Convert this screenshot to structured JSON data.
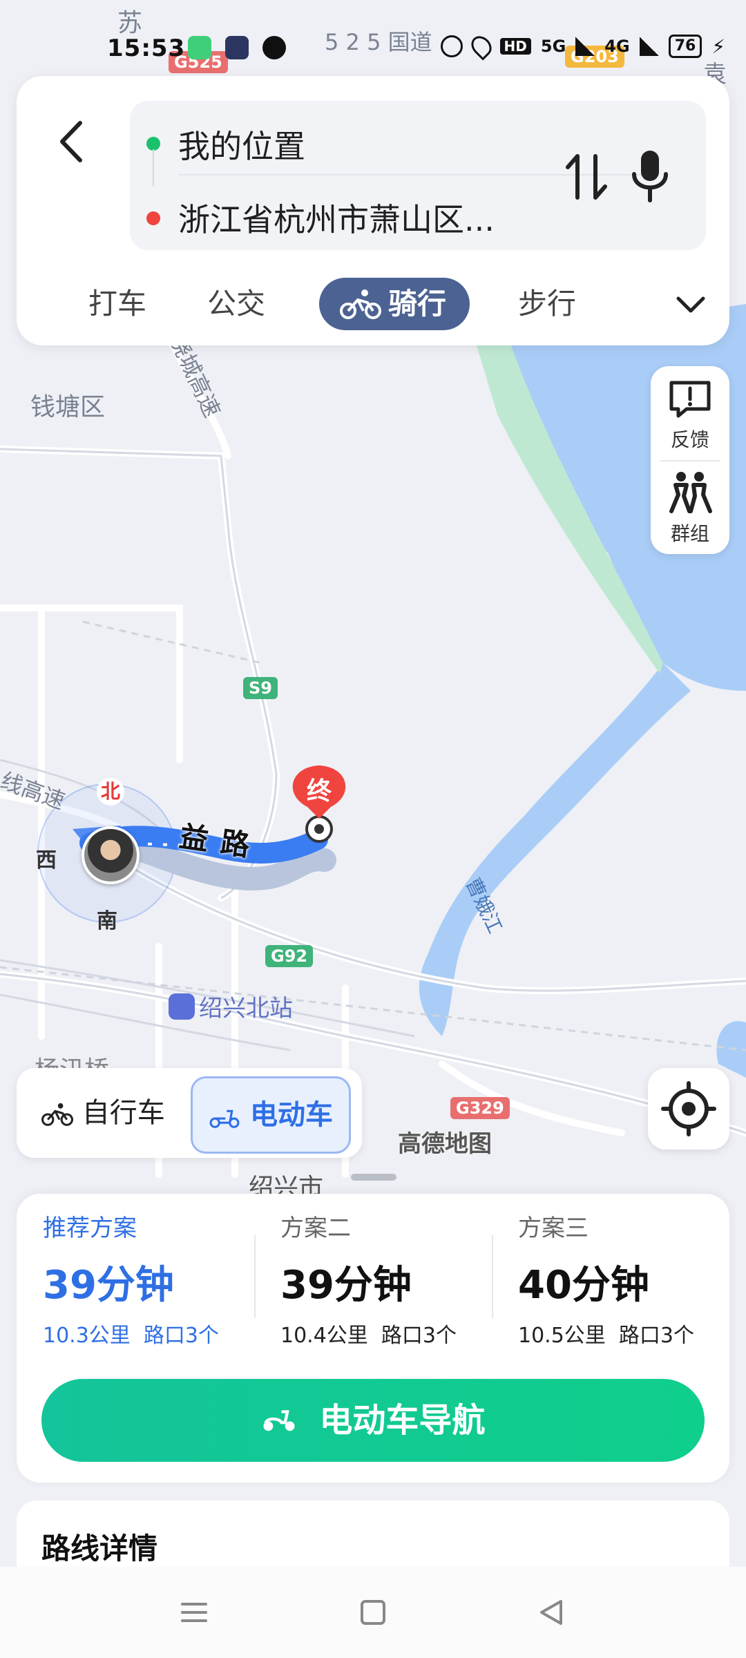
{
  "status_bar": {
    "time": "15:53",
    "network_1": "5G",
    "network_2": "4G",
    "battery": "76"
  },
  "search": {
    "origin": "我的位置",
    "destination": "浙江省杭州市萧山区..."
  },
  "mode_tabs": [
    {
      "label": "打车"
    },
    {
      "label": "公交"
    },
    {
      "label": "骑行"
    },
    {
      "label": "步行"
    }
  ],
  "side_panel": {
    "feedback_label": "反馈",
    "group_label": "群组"
  },
  "map": {
    "district_label": "钱塘区",
    "highway_label": "绕城高速",
    "expressway_label": "线高速",
    "road_label": "益路",
    "national_road_label": "5 2 5 国道",
    "river_label": "曹娥江",
    "station_label": "绍兴北站",
    "city_label": "绍兴市",
    "town_label": "杨汛桥",
    "su_label": "苏",
    "yuan_label": "袁花",
    "end_marker": "终",
    "compass": {
      "north": "北",
      "west": "西",
      "south": "南"
    },
    "shields": {
      "s9": "S9",
      "g92": "G92",
      "g329": "G329",
      "g525": "G525",
      "g203": "G203"
    },
    "colors": {
      "route": "#3a7cf2",
      "water": "#a9cdf7",
      "green": "#bfe8d2",
      "end_marker": "#f0443f"
    }
  },
  "vehicle_toggle": {
    "bike_label": "自行车",
    "ebike_label": "电动车"
  },
  "map_logo": "高德地图",
  "plans": [
    {
      "name": "推荐方案",
      "time": "39分钟",
      "distance": "10.3公里",
      "crossings": "路口3个"
    },
    {
      "name": "方案二",
      "time": "39分钟",
      "distance": "10.4公里",
      "crossings": "路口3个"
    },
    {
      "name": "方案三",
      "time": "40分钟",
      "distance": "10.5公里",
      "crossings": "路口3个"
    }
  ],
  "nav_button_label": "电动车导航",
  "route_details_title": "路线详情"
}
